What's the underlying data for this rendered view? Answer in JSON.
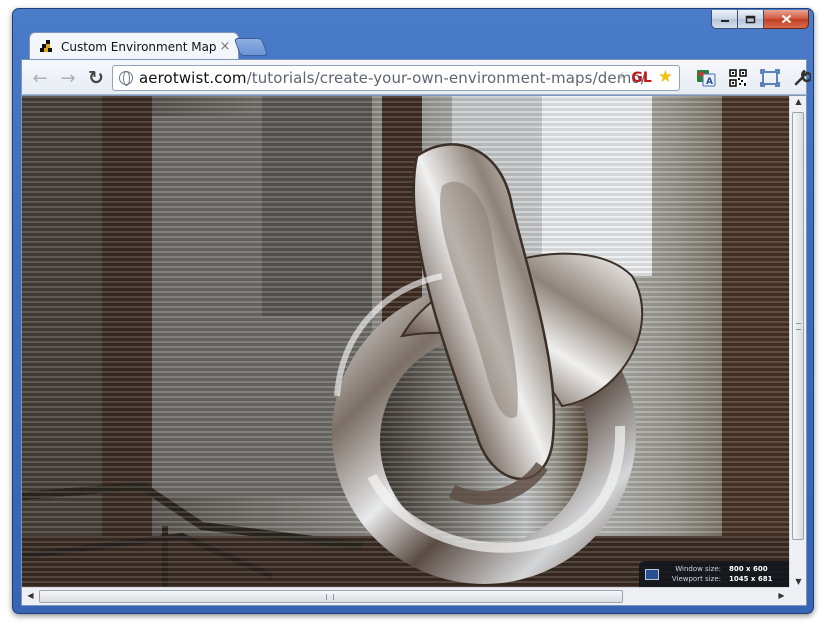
{
  "window": {
    "controls": [
      "minimize",
      "maximize",
      "close"
    ]
  },
  "tab": {
    "title": "Custom Environment Map",
    "icon": "aerotwist-favicon",
    "close": "×"
  },
  "toolbar": {
    "back_icon": "←",
    "forward_icon": "→",
    "reload_icon": "↻",
    "url_host": "aerotwist.com",
    "url_path": "/tutorials/create-your-own-environment-maps/demo/",
    "gl_badge": "GL",
    "star_icon": "★",
    "bolt_icon": "⚡",
    "wrench_icon": "🔧"
  },
  "viewport": {
    "scene": "3D chrome torus knot reflecting an office interior with window blinds",
    "size_badge": {
      "window_label": "Window size:",
      "window_value": "800 x 600",
      "viewport_label": "Viewport size:",
      "viewport_value": "1045 x 681"
    },
    "scroll_left": "◀",
    "scroll_right": "▶",
    "scroll_up": "▲",
    "scroll_down": "▼"
  }
}
